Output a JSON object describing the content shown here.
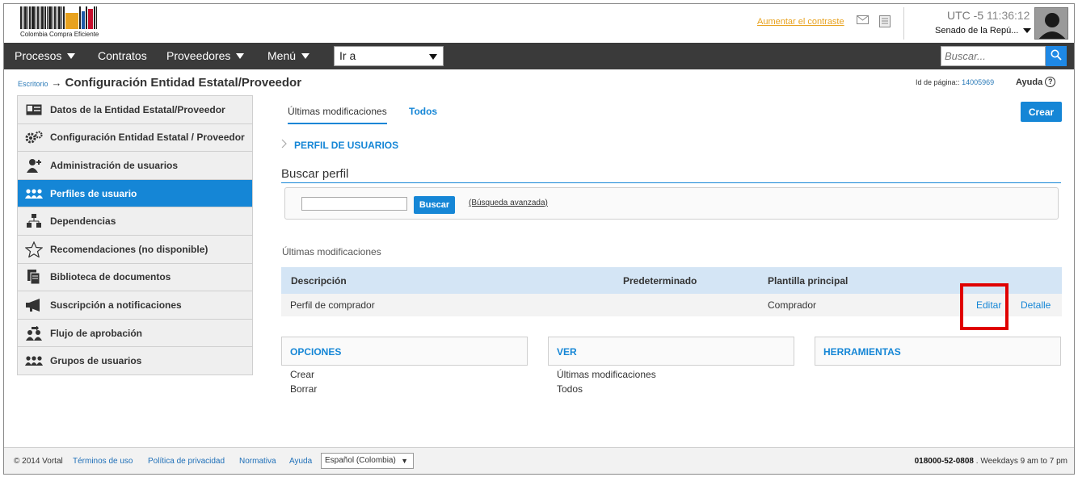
{
  "header": {
    "logo_text": "Colombia Compra Eficiente",
    "contrast_link": "Aumentar el contraste",
    "timezone": "UTC -5",
    "time": "11:36:12",
    "organization": "Senado de la Repú..."
  },
  "navbar": {
    "items": [
      {
        "label": "Procesos",
        "has_menu": true
      },
      {
        "label": "Contratos",
        "has_menu": false
      },
      {
        "label": "Proveedores",
        "has_menu": true
      },
      {
        "label": "Menú",
        "has_menu": true
      }
    ],
    "goto_value": "Ir a",
    "search_placeholder": "Buscar..."
  },
  "breadcrumb": {
    "root": "Escritorio",
    "arrow": "→",
    "title": "Configuración Entidad Estatal/Proveedor"
  },
  "page_info": {
    "id_label": "Id de página::",
    "id_value": "14005969",
    "help_label": "Ayuda"
  },
  "sidebar": {
    "items": [
      {
        "label": "Datos de la Entidad Estatal/Proveedor",
        "icon": "id-card-icon",
        "active": false
      },
      {
        "label": "Configuración Entidad Estatal / Proveedor",
        "icon": "gears-icon",
        "active": false
      },
      {
        "label": "Administración de usuarios",
        "icon": "user-add-icon",
        "active": false
      },
      {
        "label": "Perfiles de usuario",
        "icon": "users-group-icon",
        "active": true
      },
      {
        "label": "Dependencias",
        "icon": "org-chart-icon",
        "active": false
      },
      {
        "label": "Recomendaciones (no disponible)",
        "icon": "star-icon",
        "active": false
      },
      {
        "label": "Biblioteca de documentos",
        "icon": "documents-icon",
        "active": false
      },
      {
        "label": "Suscripción a notificaciones",
        "icon": "megaphone-icon",
        "active": false
      },
      {
        "label": "Flujo de aprobación",
        "icon": "approval-flow-icon",
        "active": false
      },
      {
        "label": "Grupos de usuarios",
        "icon": "user-groups-icon",
        "active": false
      }
    ]
  },
  "tabs": {
    "recent": "Últimas modificaciones",
    "all": "Todos"
  },
  "create_label": "Crear",
  "section_label": "PERFIL DE USUARIOS",
  "search_profile": {
    "title": "Buscar perfil",
    "input_value": "",
    "button_label": "Buscar",
    "advanced_link": "(Búsqueda avanzada)"
  },
  "recent_label": "Últimas modificaciones",
  "table": {
    "columns": [
      "Descripción",
      "Predeterminado",
      "Plantilla principal"
    ],
    "rows": [
      {
        "description": "Perfil de comprador",
        "default": "",
        "template": "Comprador",
        "edit": "Editar",
        "detail": "Detalle"
      }
    ]
  },
  "panels": {
    "options": {
      "title": "OPCIONES",
      "links": [
        "Crear",
        "Borrar"
      ]
    },
    "view": {
      "title": "VER",
      "links": [
        "Últimas modificaciones",
        "Todos"
      ]
    },
    "tools": {
      "title": "HERRAMIENTAS"
    }
  },
  "footer": {
    "copyright": "© 2014 Vortal",
    "links": [
      "Términos de uso",
      "Política de privacidad",
      "Normativa",
      "Ayuda"
    ],
    "language": "Español (Colombia)",
    "phone": "018000-52-0808",
    "separator": ".",
    "hours": "Weekdays 9 am to 7 pm"
  },
  "colors": {
    "accent": "#1586d6",
    "navbar": "#3a3a3a",
    "highlight": "#e00000",
    "contrast_link": "#e8a21f"
  }
}
